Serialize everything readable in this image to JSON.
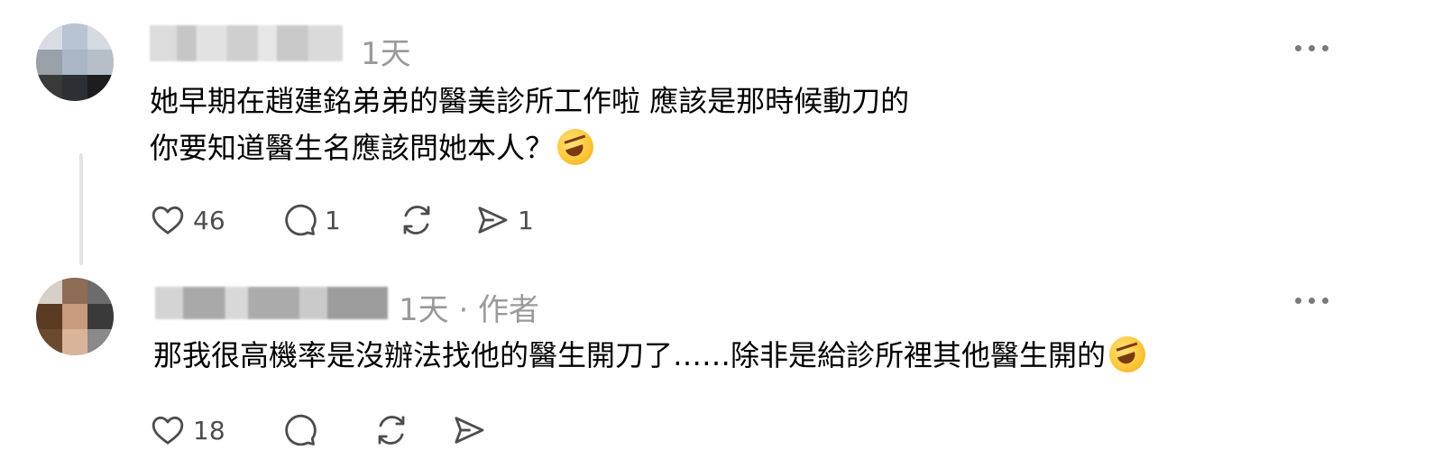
{
  "comments": [
    {
      "meta": "1天",
      "text_lines": [
        "她早期在趙建銘弟弟的醫美診所工作啦 應該是那時候動刀的",
        "你要知道醫生名應該問她本人？"
      ],
      "emoji": "rolling-on-floor-laughing-emoji",
      "likes": "46",
      "replies": "1",
      "reposts": "",
      "shares": "1"
    },
    {
      "meta": "1天 · 作者",
      "text_lines": [
        "那我很高機率是沒辦法找他的醫生開刀了……除非是給診所裡其他醫生開的"
      ],
      "emoji": "rolling-on-floor-laughing-emoji",
      "likes": "18",
      "replies": "",
      "reposts": "",
      "shares": ""
    }
  ],
  "icons": {
    "like": "heart-icon",
    "reply": "comment-bubble-icon",
    "repost": "repost-icon",
    "share": "send-icon",
    "more": "more-options-icon"
  },
  "colors": {
    "text": "#000000",
    "meta": "#9a9a9a",
    "icon": "#4d4d4d",
    "thread_line": "#e4e4e4"
  }
}
